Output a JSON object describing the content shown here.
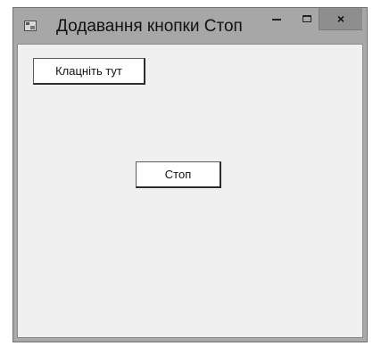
{
  "window": {
    "title": "Додавання кнопки Стоп",
    "icon": "form-app-icon",
    "controls": {
      "minimize_icon": "minimize-icon",
      "maximize_icon": "maximize-icon",
      "close_label": "×"
    }
  },
  "form": {
    "click_button_label": "Клацніть тут",
    "stop_button_label": "Стоп"
  },
  "colors": {
    "titlebar": "#a7a7a7",
    "close_button": "#8e8e8e",
    "client_area": "#f0f0f0",
    "button_face": "#ffffff"
  }
}
